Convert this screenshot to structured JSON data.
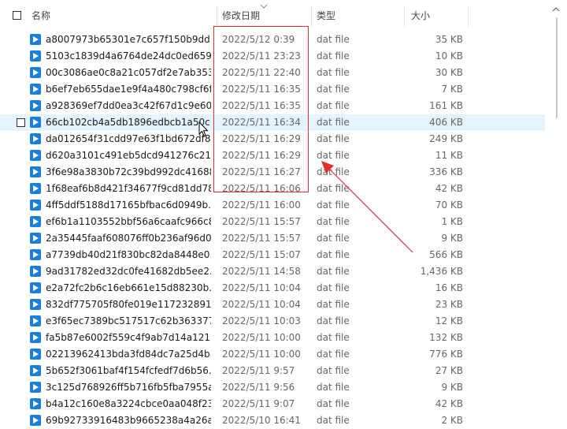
{
  "header": {
    "name_label": "名称",
    "date_label": "修改日期",
    "type_label": "类型",
    "size_label": "大小"
  },
  "colors": {
    "annotation_red": "#e03030",
    "file_icon_blue": "#1a7fd8",
    "hover_row": "#e5f3ff"
  },
  "files": [
    {
      "name": "a8007973b65301e7c657f150b9dd...",
      "date": "2022/5/12 0:39",
      "type": "dat file",
      "size": "35 KB"
    },
    {
      "name": "5103c1839d4a6764de24dc0ed659...",
      "date": "2022/5/11 23:23",
      "type": "dat file",
      "size": "10 KB"
    },
    {
      "name": "00c3086ae0c8a21c057df2e7ab353...",
      "date": "2022/5/11 22:40",
      "type": "dat file",
      "size": "30 KB"
    },
    {
      "name": "b6ef7eb655dae1e9f4a480c798cf6f...",
      "date": "2022/5/11 16:35",
      "type": "dat file",
      "size": "7 KB"
    },
    {
      "name": "a928369ef7dd0ea3c42f67d1c9e60...",
      "date": "2022/5/11 16:35",
      "type": "dat file",
      "size": "161 KB"
    },
    {
      "name": "66cb102cb4a5db1896edbcb1a50c...",
      "date": "2022/5/11 16:34",
      "type": "dat file",
      "size": "406 KB"
    },
    {
      "name": "da012654f31cdd97e63f1bd672df8...",
      "date": "2022/5/11 16:29",
      "type": "dat file",
      "size": "249 KB"
    },
    {
      "name": "d620a3101c491eb5dcd941276c21...",
      "date": "2022/5/11 16:29",
      "type": "dat file",
      "size": "11 KB"
    },
    {
      "name": "3f6e98a3830b72c39bd992dc41688...",
      "date": "2022/5/11 16:27",
      "type": "dat file",
      "size": "336 KB"
    },
    {
      "name": "1f68eaf6b8d421f34677f9cd81dd78...",
      "date": "2022/5/11 16:06",
      "type": "dat file",
      "size": "42 KB"
    },
    {
      "name": "4ff5ddf5188d17165bfbac6d0949b...",
      "date": "2022/5/11 16:00",
      "type": "dat file",
      "size": "70 KB"
    },
    {
      "name": "ef6b1a1103552bbf56a6caafc966c8...",
      "date": "2022/5/11 15:57",
      "type": "dat file",
      "size": "1 KB"
    },
    {
      "name": "2a35445faaf608076ff0b236af96d0...",
      "date": "2022/5/11 15:57",
      "type": "dat file",
      "size": "9 KB"
    },
    {
      "name": "a7739db40d21f830bc82da8448e0...",
      "date": "2022/5/11 15:07",
      "type": "dat file",
      "size": "566 KB"
    },
    {
      "name": "9ad31782ed32dc0fe41682db5ee2...",
      "date": "2022/5/11 14:58",
      "type": "dat file",
      "size": "1,436 KB"
    },
    {
      "name": "e2a72fc2b6c16eb661e15d88230b...",
      "date": "2022/5/11 10:04",
      "type": "dat file",
      "size": "16 KB"
    },
    {
      "name": "832df775705f80fe019e117232891 6...",
      "date": "2022/5/11 10:04",
      "type": "dat file",
      "size": "23 KB"
    },
    {
      "name": "e3f65ec7389bc517517c62b363377...",
      "date": "2022/5/11 10:03",
      "type": "dat file",
      "size": "12 KB"
    },
    {
      "name": "fa5b87e6002f559c4f9ab7d14a121...",
      "date": "2022/5/11 10:00",
      "type": "dat file",
      "size": "132 KB"
    },
    {
      "name": "02213962413bda3fd84dc7a25d4b...",
      "date": "2022/5/11 10:00",
      "type": "dat file",
      "size": "776 KB"
    },
    {
      "name": "5b652f3061baf4f154fcfedf7d6b56...",
      "date": "2022/5/11 9:57",
      "type": "dat file",
      "size": "27 KB"
    },
    {
      "name": "3c125d768926ff5b716fb5fba7955a...",
      "date": "2022/5/11 9:56",
      "type": "dat file",
      "size": "9 KB"
    },
    {
      "name": "b4a12c160e8a3224cbce0aa048f23...",
      "date": "2022/5/11 9:07",
      "type": "dat file",
      "size": "42 KB"
    },
    {
      "name": "69b92733916483b9665238a4a26a...",
      "date": "2022/5/10 16:41",
      "type": "dat file",
      "size": "2 KB"
    }
  ]
}
